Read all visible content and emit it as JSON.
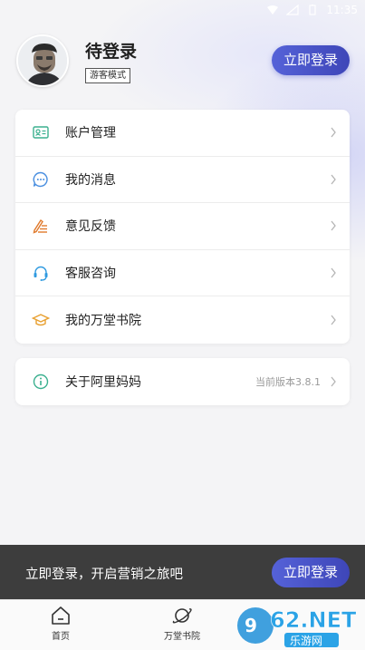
{
  "status_bar": {
    "time": "11:35"
  },
  "profile": {
    "name": "待登录",
    "badge": "游客模式",
    "login_button": "立即登录"
  },
  "menu": {
    "items": [
      {
        "label": "账户管理",
        "icon": "account-card-icon",
        "color": "#3bb08f"
      },
      {
        "label": "我的消息",
        "icon": "message-bubble-icon",
        "color": "#4a8fe0"
      },
      {
        "label": "意见反馈",
        "icon": "feedback-pen-icon",
        "color": "#e07a2c"
      },
      {
        "label": "客服咨询",
        "icon": "headset-icon",
        "color": "#2f9ae0"
      },
      {
        "label": "我的万堂书院",
        "icon": "graduation-cap-icon",
        "color": "#e8a030"
      }
    ]
  },
  "about": {
    "label": "关于阿里妈妈",
    "version": "当前版本3.8.1",
    "icon": "info-circle-icon",
    "color": "#3bb08f"
  },
  "banner": {
    "text": "立即登录，开启营销之旅吧",
    "button": "立即登录"
  },
  "tabs": [
    {
      "label": "首页",
      "icon": "home-icon"
    },
    {
      "label": "万堂书院",
      "icon": "planet-icon"
    }
  ],
  "watermark": {
    "text": "962.NET",
    "sub": "乐游网"
  },
  "colors": {
    "accent": "#4550c8",
    "banner_bg": "#3d3d3d"
  }
}
